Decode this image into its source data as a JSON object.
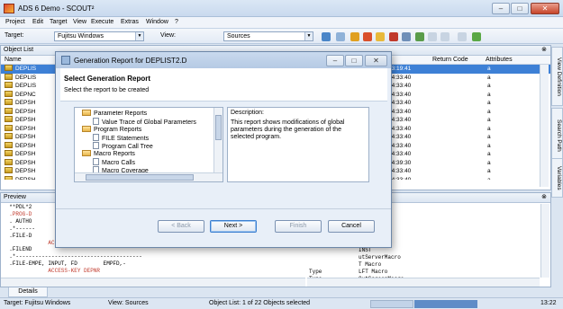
{
  "window": {
    "title": "ADS 6 Demo - SCOUT²"
  },
  "menu": [
    "Project",
    "Edit",
    "Target",
    "View",
    "Execute",
    "Extras",
    "Window",
    "?"
  ],
  "toolbar": {
    "target_label": "Target:",
    "target_value": "Fujitsu Windows",
    "view_label": "View:",
    "view_value": "Sources"
  },
  "object_list": {
    "title": "Object List",
    "columns": {
      "name": "Name",
      "return_code": "Return Code",
      "attributes": "Attributes"
    },
    "rows": [
      {
        "name": "DEPLIS",
        "time": "13:19:41",
        "attr": "a"
      },
      {
        "name": "DEPLIS",
        "time": "14:33:40",
        "attr": "a"
      },
      {
        "name": "DEPLIS",
        "time": "14:33:40",
        "attr": "a"
      },
      {
        "name": "DEPNC",
        "time": "14:33:40",
        "attr": "a"
      },
      {
        "name": "DEPSH",
        "time": "14:33:40",
        "attr": "a"
      },
      {
        "name": "DEPSH",
        "time": "14:33:40",
        "attr": "a"
      },
      {
        "name": "DEPSH",
        "time": "14:33:40",
        "attr": "a"
      },
      {
        "name": "DEPSH",
        "time": "14:33:40",
        "attr": "a"
      },
      {
        "name": "DEPSH",
        "time": "14:33:40",
        "attr": "a"
      },
      {
        "name": "DEPSH",
        "time": "14:33:40",
        "attr": "a"
      },
      {
        "name": "DEPSH",
        "time": "14:33:40",
        "attr": "a"
      },
      {
        "name": "DEPSH",
        "time": "14:39:30",
        "attr": "a"
      },
      {
        "name": "DEPSH",
        "time": "14:33:40",
        "attr": "a"
      },
      {
        "name": "DEPSH",
        "time": "14:33:40",
        "attr": "a"
      },
      {
        "name": "DEPSH",
        "time": "14:33:40",
        "attr": "a"
      }
    ]
  },
  "side_tabs": [
    "View Definition",
    "Search Path",
    "Variables"
  ],
  "preview": {
    "title": "Preview",
    "code_lines": [
      "  **PDL*2",
      "  .PROG-D",
      "  . AUTHO",
      "  .*------",
      "  .FILE-D",
      "              ACCESS-KEY DESIGNATION",
      "  .FILEND",
      "  .*---------------------------------------",
      "  .FILE-EMPE, INPUT, FD        EMPFD,-",
      "              ACCESS-KEY DEPNR"
    ],
    "right_lines": [
      {
        "type": "",
        "value": "INST"
      },
      {
        "type": "",
        "value": "utServerMacro"
      },
      {
        "type": "",
        "value": "T Macro"
      },
      {
        "type": "Type",
        "value": "LFT Macro"
      },
      {
        "type": "Type",
        "value": "OutScreenMacro"
      },
      {
        "type": "Type",
        "value": "Macro"
      },
      {
        "type": "Type",
        "value": "Common Macro"
      }
    ],
    "build_line": "... Build searchpath done."
  },
  "details_tab": "Details",
  "status": {
    "target": "Target: Fujitsu Windows",
    "view": "View: Sources",
    "objects": "Object List: 1 of 22 Objects selected",
    "time": "13:22"
  },
  "dialog": {
    "title": "Generation Report for DEPLIST2.D",
    "heading": "Select Generation Report",
    "subheading": "Select the report to be created",
    "tree": [
      {
        "label": "Parameter Reports",
        "kind": "folder",
        "level": 0
      },
      {
        "label": "Value Trace of Global Parameters",
        "kind": "doc",
        "level": 1
      },
      {
        "label": "Program Reports",
        "kind": "folder",
        "level": 0
      },
      {
        "label": "FILE Statements",
        "kind": "doc",
        "level": 1
      },
      {
        "label": "Program Call Tree",
        "kind": "doc",
        "level": 1
      },
      {
        "label": "Macro Reports",
        "kind": "folder",
        "level": 0
      },
      {
        "label": "Macro Calls",
        "kind": "doc",
        "level": 1
      },
      {
        "label": "Macro Coverage",
        "kind": "doc",
        "level": 1
      }
    ],
    "description_label": "Description:",
    "description_text": "This report shows modifications of global parameters during the generation of the selected program.",
    "buttons": {
      "back": "< Back",
      "next": "Next >",
      "finish": "Finish",
      "cancel": "Cancel"
    }
  }
}
